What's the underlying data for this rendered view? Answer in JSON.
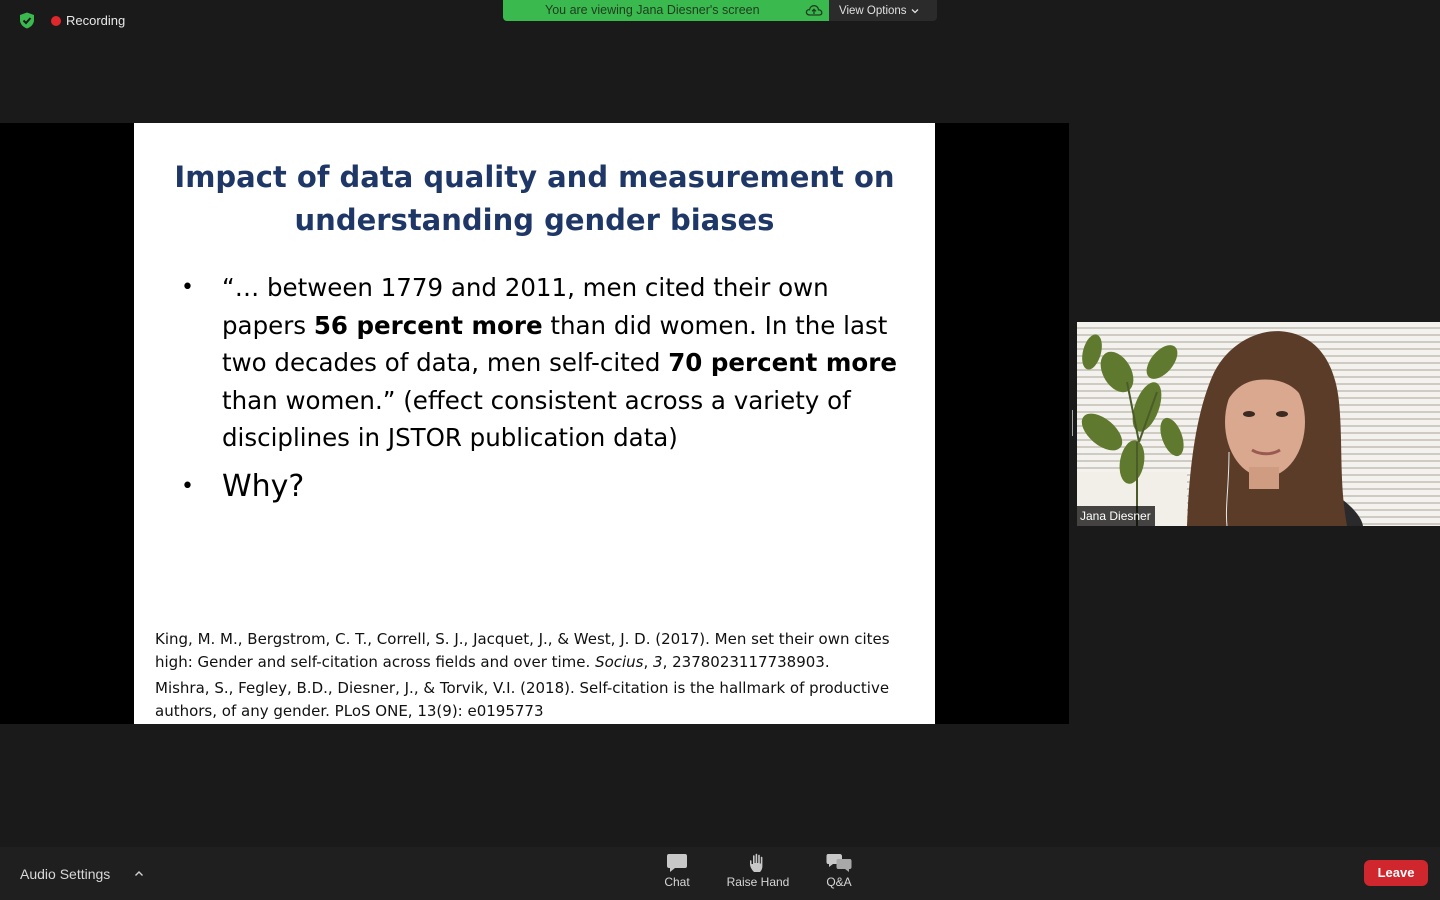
{
  "top_bar": {
    "recording_label": "Recording",
    "banner_text": "You are viewing Jana Diesner's screen",
    "view_options_label": "View Options"
  },
  "slide": {
    "title_line1": "Impact of data quality and measurement on",
    "title_line2": "understanding gender biases",
    "bullet1": {
      "part1": "“… between 1779 and 2011, men cited their own papers ",
      "bold1": "56 percent more",
      "part2": " than did women. In the last two decades of data, men self-cited ",
      "bold2": "70 percent more",
      "part3": " than women.” (effect consistent across a variety of disciplines in JSTOR publication data)"
    },
    "bullet2": "Why?",
    "ref1": {
      "text_before": "King, M. M., Bergstrom, C. T., Correll, S. J., Jacquet, J., & West, J. D. (2017). Men set their own cites high: Gender and self-citation across fields and over time. ",
      "journal": "Socius",
      "sep": ", ",
      "volume": "3",
      "text_after": ", 2378023117738903."
    },
    "ref2": "Mishra, S., Fegley, B.D., Diesner, J., & Torvik, V.I. (2018). Self-citation is the hallmark of productive authors, of any gender. PLoS ONE, 13(9): e0195773"
  },
  "participant": {
    "name": "Jana Diesner"
  },
  "toolbar": {
    "audio_settings_label": "Audio Settings",
    "chat_label": "Chat",
    "raise_hand_label": "Raise Hand",
    "qa_label": "Q&A",
    "leave_label": "Leave"
  },
  "colors": {
    "banner_green": "#3aba4e",
    "slide_title": "#1e3766",
    "leave_red": "#d0262d",
    "recording_red": "#e0272d"
  },
  "icons": [
    "shield-check-icon",
    "recording-dot-icon",
    "cloud-upload-icon",
    "chevron-down-icon",
    "chevron-up-icon",
    "chat-bubble-icon",
    "raise-hand-icon",
    "qa-bubbles-icon"
  ]
}
